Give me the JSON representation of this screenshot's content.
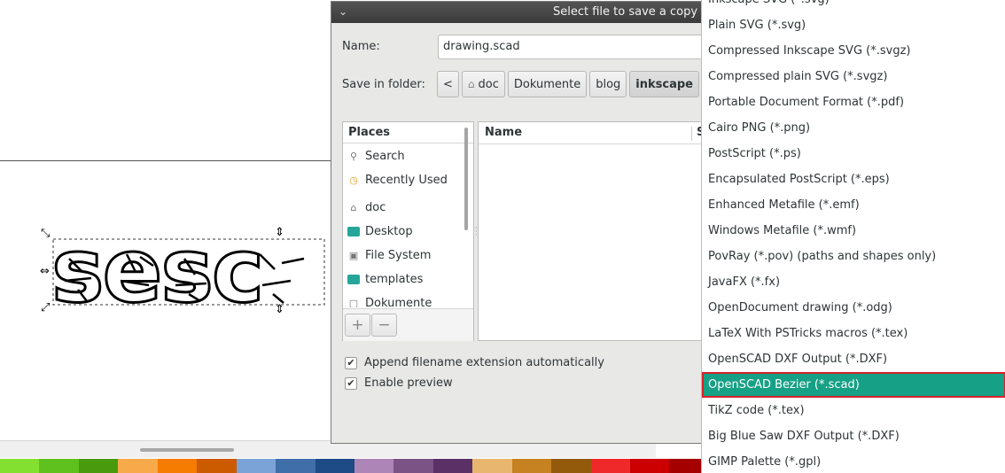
{
  "canvas": {
    "palette": [
      "#84e030",
      "#5fc11d",
      "#4a9a0e",
      "#f8a94a",
      "#f57c00",
      "#cc5b00",
      "#7ba3d8",
      "#3f6ea9",
      "#1e4a86",
      "#ad85b6",
      "#7b5485",
      "#5a3066",
      "#e8b66f",
      "#c68120",
      "#935a0c",
      "#ef2929",
      "#cc0000",
      "#a40000"
    ]
  },
  "dialog": {
    "title": "Select file to save a copy",
    "name_label": "Name:",
    "name_value": "drawing.scad",
    "folder_label": "Save in folder:",
    "path": {
      "back": "<",
      "segments": [
        "doc",
        "Dokumente",
        "blog",
        "inkscape"
      ]
    },
    "places": {
      "header": "Places",
      "items": [
        {
          "label": "Search",
          "icon": "search-icon"
        },
        {
          "label": "Recently Used",
          "icon": "clock-icon"
        },
        {
          "label": "doc",
          "icon": "home-icon"
        },
        {
          "label": "Desktop",
          "icon": "desktop-icon"
        },
        {
          "label": "File System",
          "icon": "drive-icon"
        },
        {
          "label": "templates",
          "icon": "folder-icon"
        },
        {
          "label": "Dokumente",
          "icon": "folder-icon"
        }
      ],
      "add": "+",
      "remove": "−"
    },
    "files": {
      "name_col": "Name",
      "size_col": "S"
    },
    "append_ext_label": "Append filename extension automatically",
    "enable_preview_label": "Enable preview"
  },
  "format_list": {
    "items": [
      "Inkscape SVG (*.svg)",
      "Plain SVG (*.svg)",
      "Compressed Inkscape SVG (*.svgz)",
      "Compressed plain SVG (*.svgz)",
      "Portable Document Format (*.pdf)",
      "Cairo PNG (*.png)",
      "PostScript (*.ps)",
      "Encapsulated PostScript (*.eps)",
      "Enhanced Metafile (*.emf)",
      "Windows Metafile (*.wmf)",
      "PovRay (*.pov) (paths and shapes only)",
      "JavaFX (*.fx)",
      "OpenDocument drawing (*.odg)",
      "LaTeX With PSTricks macros (*.tex)",
      "OpenSCAD DXF Output (*.DXF)",
      "OpenSCAD Bezier (*.scad)",
      "TikZ code (*.tex)",
      "Big Blue Saw DXF Output (*.DXF)",
      "GIMP Palette (*.gpl)"
    ],
    "selected": "OpenSCAD Bezier (*.scad)"
  }
}
